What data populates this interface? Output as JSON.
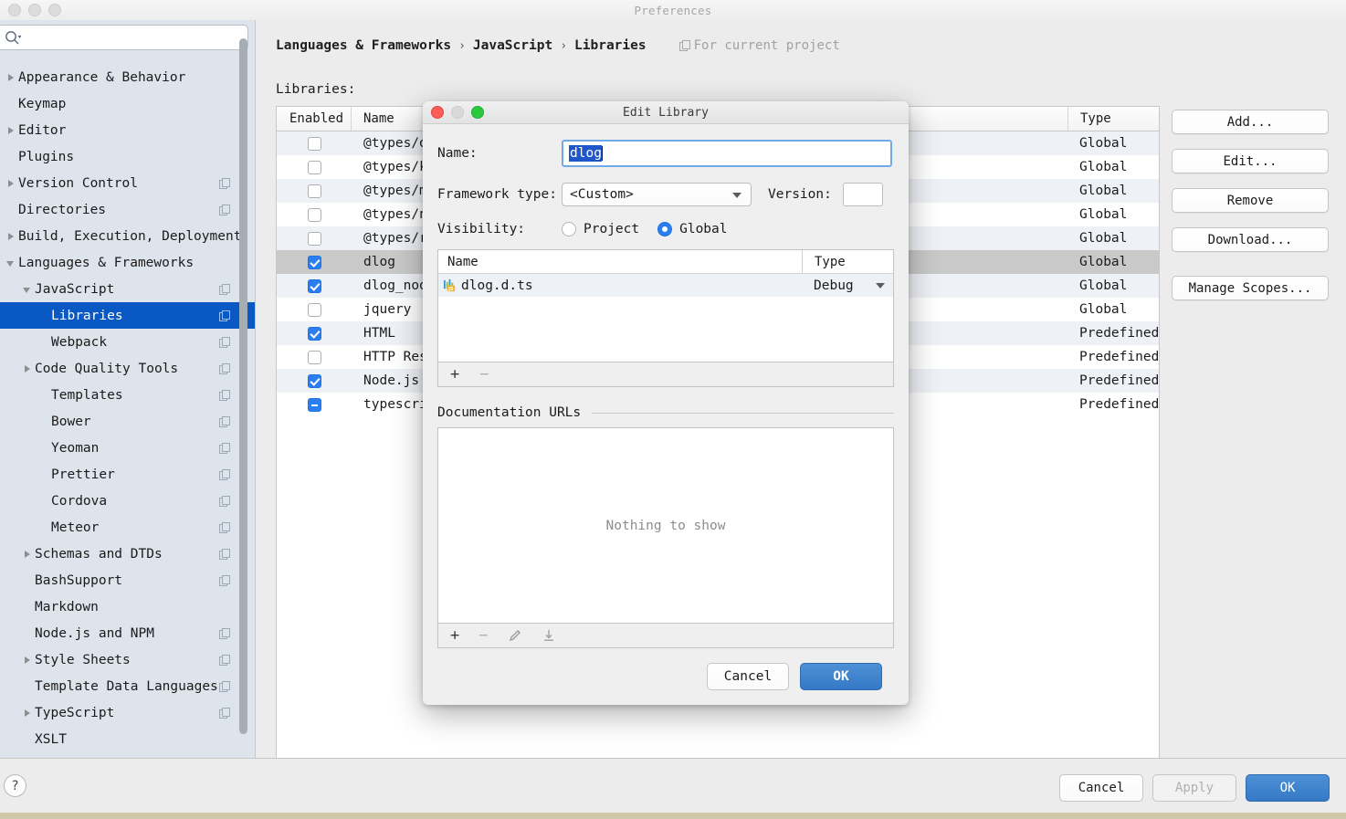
{
  "window": {
    "title": "Preferences",
    "traffic_lights": [
      "close",
      "minimize",
      "zoom"
    ]
  },
  "sidebar": {
    "search_placeholder": "",
    "items": [
      {
        "label": "Appearance & Behavior",
        "indent": 0,
        "arrow": "right",
        "copy": false,
        "selected": false
      },
      {
        "label": "Keymap",
        "indent": 0,
        "arrow": "none",
        "copy": false,
        "selected": false
      },
      {
        "label": "Editor",
        "indent": 0,
        "arrow": "right",
        "copy": false,
        "selected": false
      },
      {
        "label": "Plugins",
        "indent": 0,
        "arrow": "none",
        "copy": false,
        "selected": false
      },
      {
        "label": "Version Control",
        "indent": 0,
        "arrow": "right",
        "copy": true,
        "selected": false
      },
      {
        "label": "Directories",
        "indent": 0,
        "arrow": "none",
        "copy": true,
        "selected": false
      },
      {
        "label": "Build, Execution, Deployment",
        "indent": 0,
        "arrow": "right",
        "copy": false,
        "selected": false
      },
      {
        "label": "Languages & Frameworks",
        "indent": 0,
        "arrow": "down",
        "copy": false,
        "selected": false
      },
      {
        "label": "JavaScript",
        "indent": 1,
        "arrow": "down",
        "copy": true,
        "selected": false
      },
      {
        "label": "Libraries",
        "indent": 2,
        "arrow": "none",
        "copy": true,
        "selected": true
      },
      {
        "label": "Webpack",
        "indent": 2,
        "arrow": "none",
        "copy": true,
        "selected": false
      },
      {
        "label": "Code Quality Tools",
        "indent": 1,
        "arrow": "right",
        "copy": true,
        "selected": false
      },
      {
        "label": "Templates",
        "indent": 2,
        "arrow": "none",
        "copy": true,
        "selected": false
      },
      {
        "label": "Bower",
        "indent": 2,
        "arrow": "none",
        "copy": true,
        "selected": false
      },
      {
        "label": "Yeoman",
        "indent": 2,
        "arrow": "none",
        "copy": true,
        "selected": false
      },
      {
        "label": "Prettier",
        "indent": 2,
        "arrow": "none",
        "copy": true,
        "selected": false
      },
      {
        "label": "Cordova",
        "indent": 2,
        "arrow": "none",
        "copy": true,
        "selected": false
      },
      {
        "label": "Meteor",
        "indent": 2,
        "arrow": "none",
        "copy": true,
        "selected": false
      },
      {
        "label": "Schemas and DTDs",
        "indent": 1,
        "arrow": "right",
        "copy": true,
        "selected": false
      },
      {
        "label": "BashSupport",
        "indent": 1,
        "arrow": "none",
        "copy": true,
        "selected": false
      },
      {
        "label": "Markdown",
        "indent": 1,
        "arrow": "none",
        "copy": false,
        "selected": false
      },
      {
        "label": "Node.js and NPM",
        "indent": 1,
        "arrow": "none",
        "copy": true,
        "selected": false
      },
      {
        "label": "Style Sheets",
        "indent": 1,
        "arrow": "right",
        "copy": true,
        "selected": false
      },
      {
        "label": "Template Data Languages",
        "indent": 1,
        "arrow": "none",
        "copy": true,
        "selected": false
      },
      {
        "label": "TypeScript",
        "indent": 1,
        "arrow": "right",
        "copy": true,
        "selected": false
      },
      {
        "label": "XSLT",
        "indent": 1,
        "arrow": "none",
        "copy": false,
        "selected": false
      }
    ]
  },
  "main": {
    "breadcrumb": [
      "Languages & Frameworks",
      "JavaScript",
      "Libraries"
    ],
    "breadcrumb_separator": "›",
    "scope_note": "For current project",
    "libraries_label": "Libraries:",
    "table": {
      "columns": [
        "Enabled",
        "Name",
        "Type"
      ],
      "rows": [
        {
          "enabled": "off",
          "name": "@types/dpl",
          "type": "Global",
          "selected": false
        },
        {
          "enabled": "off",
          "name": "@types/koa",
          "type": "Global",
          "selected": false
        },
        {
          "enabled": "off",
          "name": "@types/mon",
          "type": "Global",
          "selected": false
        },
        {
          "enabled": "off",
          "name": "@types/nod",
          "type": "Global",
          "selected": false
        },
        {
          "enabled": "off",
          "name": "@types/rea",
          "type": "Global",
          "selected": false
        },
        {
          "enabled": "on",
          "name": "dlog",
          "type": "Global",
          "selected": true
        },
        {
          "enabled": "on",
          "name": "dlog_node",
          "type": "Global",
          "selected": false
        },
        {
          "enabled": "off",
          "name": "jquery",
          "type": "Global",
          "selected": false
        },
        {
          "enabled": "on",
          "name": "HTML",
          "type": "Predefined",
          "selected": false
        },
        {
          "enabled": "off",
          "name": "HTTP Respo",
          "type": "Predefined",
          "selected": false
        },
        {
          "enabled": "on",
          "name": "Node.js Co",
          "type": "Predefined",
          "selected": false
        },
        {
          "enabled": "mixed",
          "name": "typescript",
          "type": "Predefined",
          "selected": false
        }
      ]
    },
    "side_buttons": [
      {
        "label": "Add..."
      },
      {
        "label": "Edit..."
      },
      {
        "label": "Remove"
      },
      {
        "label": "Download..."
      },
      {
        "label": "Manage Scopes..."
      }
    ]
  },
  "bottom_bar": {
    "help_label": "?",
    "cancel_label": "Cancel",
    "apply_label": "Apply",
    "ok_label": "OK"
  },
  "dialog": {
    "title": "Edit Library",
    "name_label": "Name:",
    "name_value": "dlog",
    "framework_label": "Framework type:",
    "framework_value": "<Custom>",
    "version_label": "Version:",
    "version_value": "",
    "visibility_label": "Visibility:",
    "visibility_options": [
      {
        "label": "Project",
        "selected": false
      },
      {
        "label": "Global",
        "selected": true
      }
    ],
    "files_table": {
      "columns": [
        "Name",
        "Type"
      ],
      "rows": [
        {
          "name": "dlog.d.ts",
          "type": "Debug",
          "icon": "typescript-definition-icon"
        }
      ]
    },
    "files_toolbar": [
      {
        "icon": "plus-icon",
        "enabled": true
      },
      {
        "icon": "minus-icon",
        "enabled": false
      }
    ],
    "docs_section_label": "Documentation URLs",
    "docs_empty_text": "Nothing to show",
    "docs_toolbar": [
      {
        "icon": "plus-icon",
        "enabled": true
      },
      {
        "icon": "minus-icon",
        "enabled": false
      },
      {
        "icon": "pencil-icon",
        "enabled": false
      },
      {
        "icon": "download-icon",
        "enabled": false
      }
    ],
    "cancel_label": "Cancel",
    "ok_label": "OK"
  },
  "colors": {
    "accent_blue": "#0a58c4",
    "primary_button": "#3579c6",
    "checkbox_blue": "#2a7ef0",
    "sidebar_bg": "#dde4ec",
    "selection_blue": "#1f56c9"
  }
}
